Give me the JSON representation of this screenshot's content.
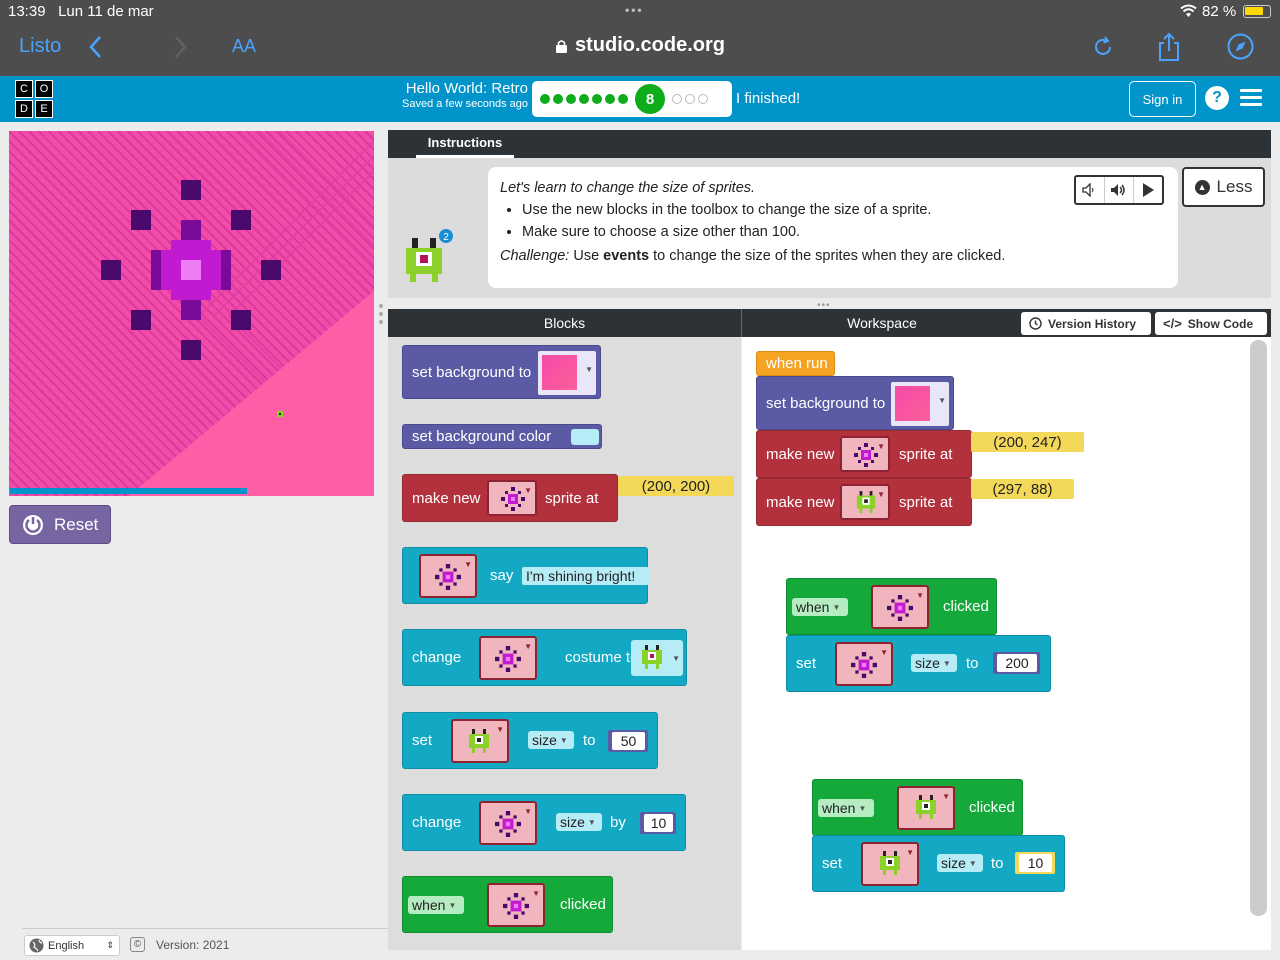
{
  "status": {
    "time": "13:39",
    "date": "Lun 11 de mar",
    "battery": "82 %"
  },
  "safari": {
    "done": "Listo",
    "text_size": "AA",
    "url": "studio.code.org"
  },
  "header": {
    "logo_letters": [
      "C",
      "O",
      "D",
      "E"
    ],
    "level_title": "Hello World: Retro",
    "saved": "Saved a few seconds ago",
    "current_level": "8",
    "completed_levels": 7,
    "remaining_levels": 3,
    "finished": "I finished!",
    "sign_in": "Sign in",
    "help": "?"
  },
  "stage": {
    "reset": "Reset"
  },
  "footer": {
    "language": "English",
    "copyright": "©",
    "version": "Version: 2021"
  },
  "instructions": {
    "tab": "Instructions",
    "avatar_badge": "2",
    "lead": "Let's learn to change the size of sprites.",
    "bullets": [
      "Use the new blocks in the toolbox to change the size of a sprite.",
      "Make sure to choose a size other than 100."
    ],
    "challenge_label": "Challenge:",
    "challenge_pre": " Use ",
    "challenge_bold": "events",
    "challenge_post": " to change the size of the sprites when they are clicked.",
    "less": "Less"
  },
  "panels": {
    "blocks": "Blocks",
    "workspace": "Workspace",
    "version_history": "Version History",
    "show_code": "Show Code"
  },
  "toolbox": {
    "set_background_to": "set background to",
    "set_background_color": "set background color",
    "make_new": "make new",
    "sprite_at": "sprite at",
    "make_pos": "(200, 200)",
    "say": "say",
    "say_text": "I'm shining bright!",
    "change": "change",
    "costume_to": "costume to",
    "set": "set",
    "size": "size",
    "to": "to",
    "set_size_val": "50",
    "change_label": "change",
    "by": "by",
    "change_size_val": "10",
    "when": "when",
    "clicked": "clicked"
  },
  "workspace": {
    "when_run": "when run",
    "set_background_to": "set background to",
    "make_new_1": "make new",
    "sprite_at_1": "sprite at",
    "pos_1": "(200, 247)",
    "make_new_2": "make new",
    "sprite_at_2": "sprite at",
    "pos_2": "(297, 88)",
    "when_1": "when",
    "clicked_1": "clicked",
    "set_1": "set",
    "size_1": "size",
    "to_1": "to",
    "val_1": "200",
    "when_2": "when",
    "clicked_2": "clicked",
    "set_2": "set",
    "size_2": "size",
    "to_2": "to",
    "val_2": "10"
  },
  "colors": {
    "code_org_teal": "#0094ca",
    "progress_green": "#0eab1c",
    "sprite_block": "#b3313c",
    "event_block": "#15a83a",
    "world_block": "#5b5ba5",
    "action_block": "#13a9c4",
    "stage_pink": "#f24ba8"
  }
}
